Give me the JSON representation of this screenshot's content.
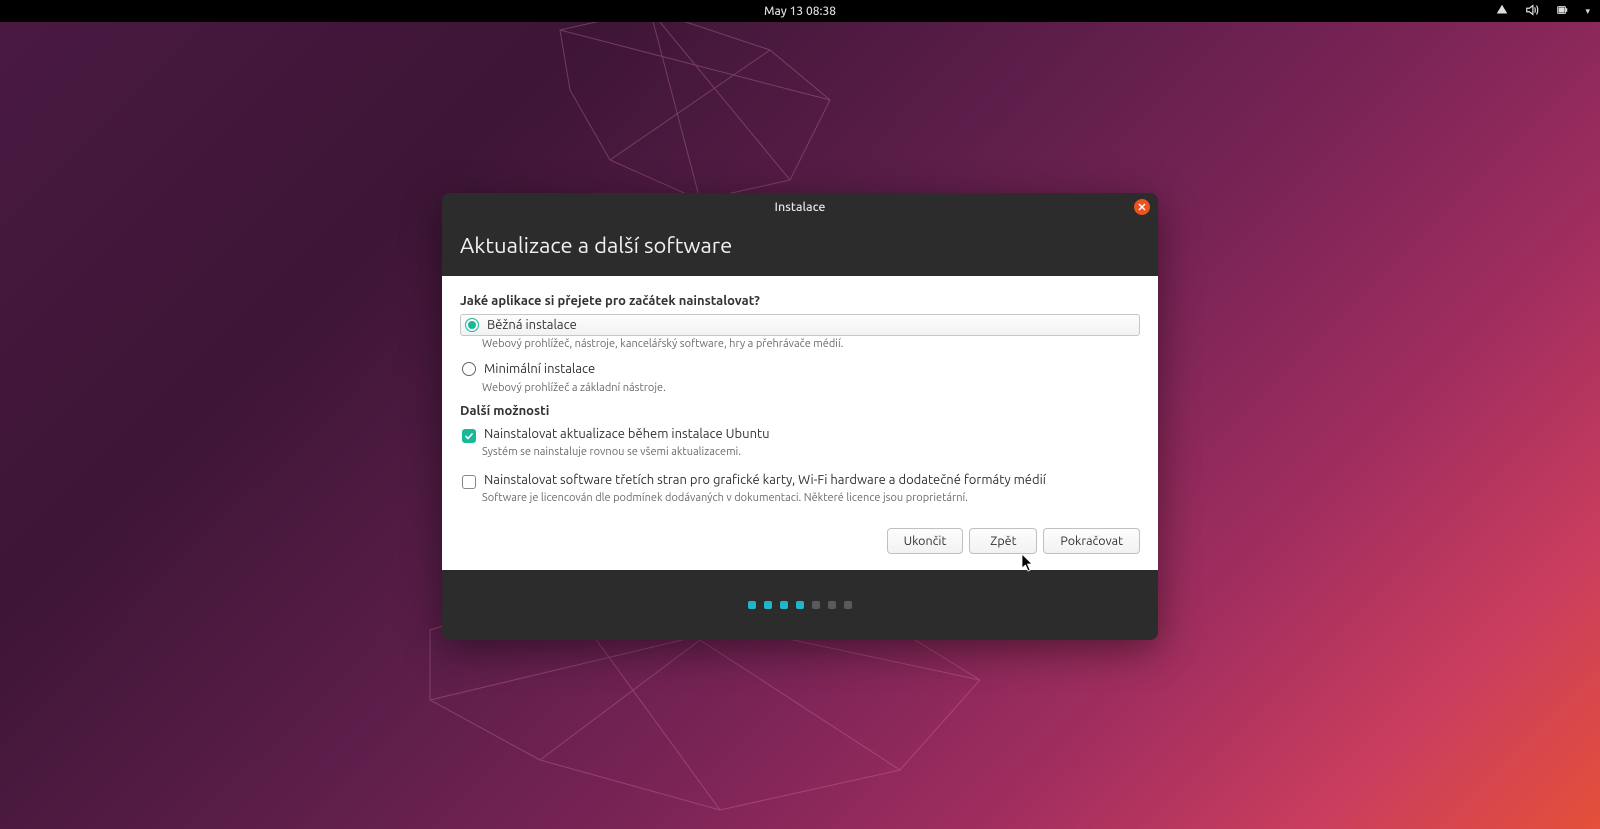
{
  "topbar": {
    "datetime": "May 13  08:38"
  },
  "installer": {
    "title": "Instalace",
    "heading": "Aktualizace a další software",
    "question": "Jaké aplikace si přejete pro začátek nainstalovat?",
    "options": [
      {
        "label": "Běžná instalace",
        "hint": "Webový prohlížeč, nástroje, kancelářský software, hry a přehrávače médií.",
        "selected": true
      },
      {
        "label": "Minimální instalace",
        "hint": "Webový prohlížeč a základní nástroje.",
        "selected": false
      }
    ],
    "other_heading": "Další možnosti",
    "checks": [
      {
        "label": "Nainstalovat aktualizace během instalace Ubuntu",
        "hint": "Systém se nainstaluje rovnou se všemi aktualizacemi.",
        "checked": true
      },
      {
        "label": "Nainstalovat software třetích stran pro grafické karty, Wi-Fi hardware a dodatečné formáty médií",
        "hint": "Software je licencován dle podmínek dodávaných v dokumentaci. Některé licence jsou proprietární.",
        "checked": false
      }
    ],
    "buttons": {
      "quit": "Ukončit",
      "back": "Zpět",
      "continue": "Pokračovat"
    },
    "progress": {
      "total": 7,
      "current": 4
    }
  }
}
